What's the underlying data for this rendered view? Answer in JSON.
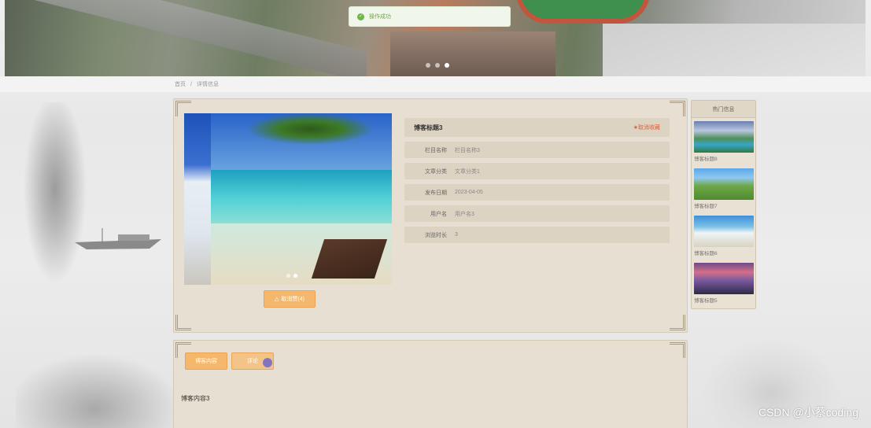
{
  "toast": {
    "icon": "check-circle-icon",
    "text": "操作成功"
  },
  "breadcrumb": {
    "home": "首页",
    "sep": "/",
    "current": "详情信息"
  },
  "detail": {
    "title": "博客标题3",
    "unfavorite_label": "★取消收藏",
    "fields": [
      {
        "label": "栏目名称",
        "value": "栏目名称3"
      },
      {
        "label": "文章分类",
        "value": "文章分类1"
      },
      {
        "label": "发布日期",
        "value": "2023-04-05"
      },
      {
        "label": "用户名",
        "value": "用户名3"
      },
      {
        "label": "浏览时长",
        "value": "3"
      }
    ],
    "fav_button": "取消赞(4)"
  },
  "hot": {
    "title": "热门信息",
    "items": [
      {
        "label": "博客标题8"
      },
      {
        "label": "博客标题7"
      },
      {
        "label": "博客标题6"
      },
      {
        "label": "博客标题5"
      }
    ]
  },
  "tabs": {
    "content": "博客内容",
    "comment": "评论"
  },
  "content_text": "博客内容3",
  "watermark": "CSDN @小蔡coding",
  "colors": {
    "accent": "#f5b76b",
    "card": "#e7dfd1",
    "danger": "#e0603c",
    "success": "#6fb54a"
  }
}
